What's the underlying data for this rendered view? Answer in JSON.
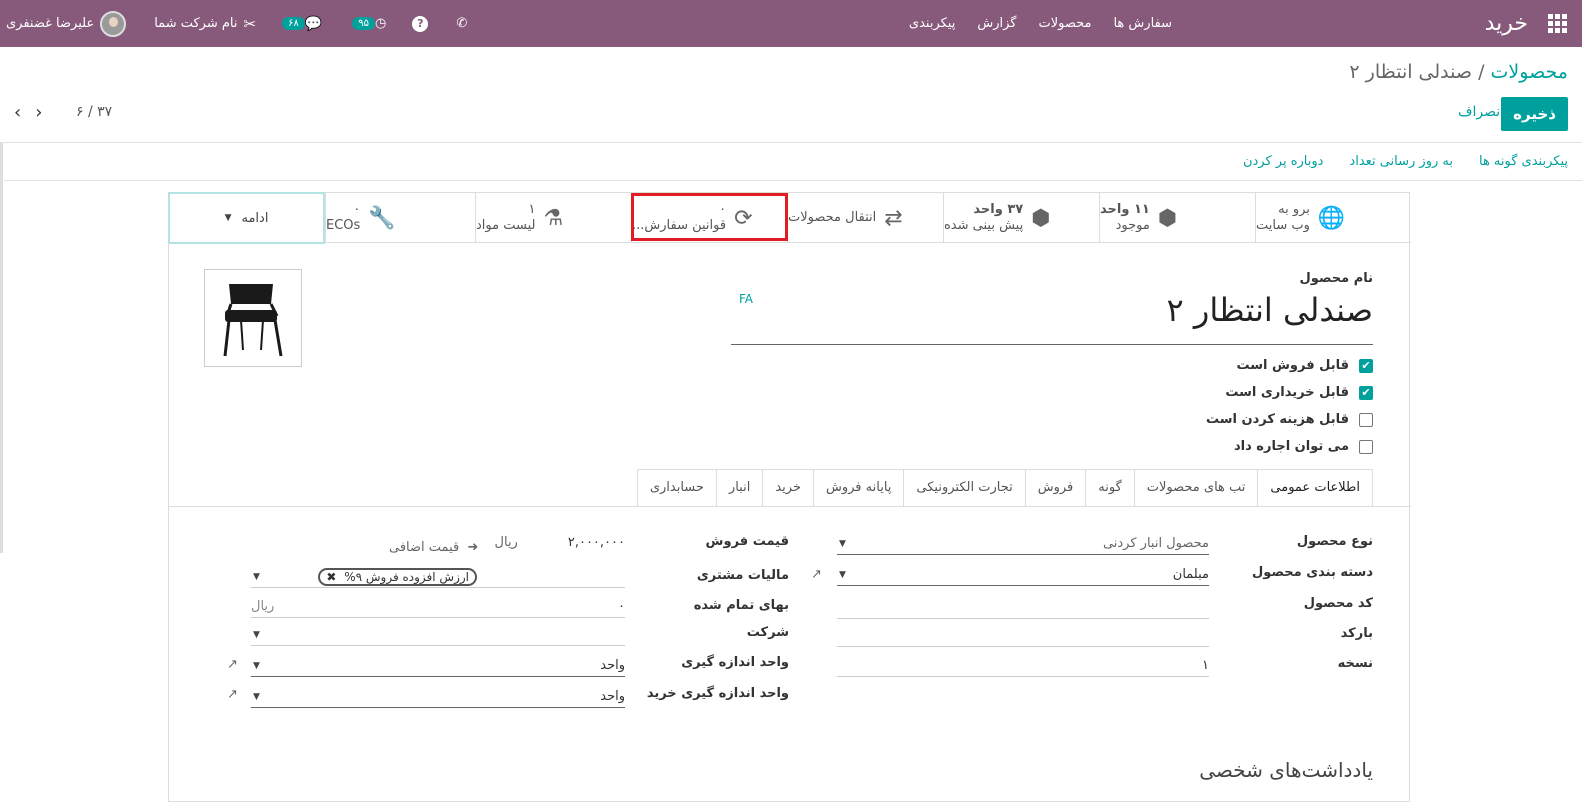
{
  "navbar": {
    "app_title": "خرید",
    "menu": [
      "سفارش ها",
      "محصولات",
      "گزارش",
      "پیکربندی"
    ],
    "messages_count": "۶۸",
    "activities_count": "۹۵",
    "company": "نام شرکت شما",
    "user": "علیرضا غضنفری"
  },
  "control_panel": {
    "breadcrumb_parent": "محصولات",
    "breadcrumb_sep": "/",
    "breadcrumb_current": "صندلی انتظار ۲",
    "save": "ذخیره",
    "discard": "انصراف",
    "pager": "۶ / ۳۷"
  },
  "statusbar": {
    "actions": [
      "پیکربندی گونه ها",
      "به روز رسانی تعداد",
      "دوباره پر کردن"
    ]
  },
  "smart_buttons": {
    "website_line1": "برو به",
    "website_line2": "وب سایت",
    "onhand_value": "۱۱ واحد",
    "onhand_label": "موجود",
    "forecast_value": "۳۷ واحد",
    "forecast_label": "پیش بینی شده",
    "moves_label": "انتقال محصولات",
    "reorder_value": "۰",
    "reorder_label": "قوانین سفارش...",
    "bom_value": "۱",
    "bom_label": "لیست مواد",
    "eco_value": "۰",
    "eco_label": "ECOs",
    "more": "ادامه"
  },
  "product": {
    "name_label": "نام محصول",
    "name": "صندلی انتظار ۲",
    "lang_tag": "FA",
    "options": [
      {
        "label": "قابل فروش است",
        "checked": true
      },
      {
        "label": "قابل خریداری است",
        "checked": true
      },
      {
        "label": "قابل هزینه کردن است",
        "checked": false
      },
      {
        "label": "می توان اجاره داد",
        "checked": false
      }
    ]
  },
  "tabs": [
    "اطلاعات عمومی",
    "تب های محصولات",
    "گونه",
    "فروش",
    "تجارت الکترونیکی",
    "پایانه فروش",
    "خرید",
    "انبار",
    "حسابداری"
  ],
  "general": {
    "type_label": "نوع محصول",
    "type_value": "محصول انبار کردنی",
    "category_label": "دسته بندی محصول",
    "category_value": "مبلمان",
    "code_label": "کد محصول",
    "barcode_label": "بارکد",
    "version_label": "نسخه",
    "version_value": "۱",
    "price_label": "قیمت فروش",
    "price_value": "۲,۰۰۰,۰۰۰",
    "price_currency": "ریال",
    "extra_price": "قیمت اضافی",
    "tax_label": "مالیات مشتری",
    "tax_tag": "ارزش افزوده فروش ۹%",
    "cost_label": "بهای تمام شده",
    "cost_value": "۰",
    "cost_currency": "ریال",
    "company_label": "شرکت",
    "uom_label": "واحد اندازه گیری",
    "uom_value": "واحد",
    "puom_label": "واحد اندازه گیری خرید",
    "puom_value": "واحد"
  },
  "notes_title": "یادداشت‌های شخصی"
}
